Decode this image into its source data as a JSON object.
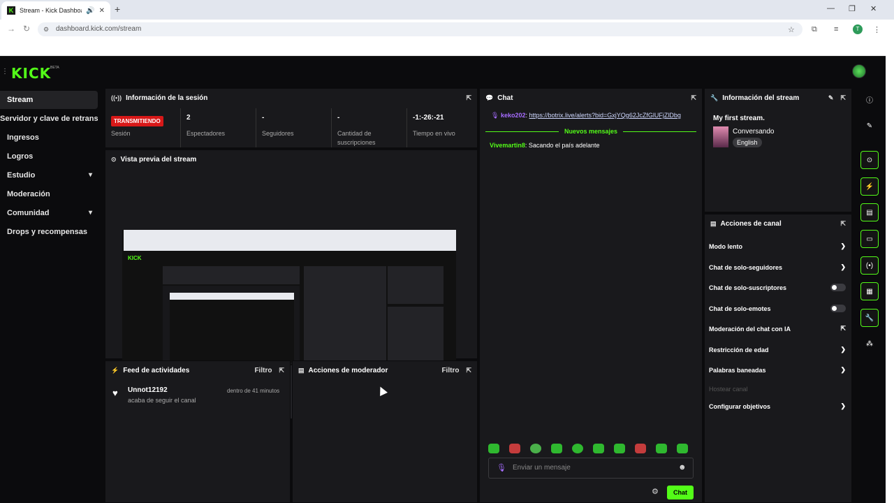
{
  "browser": {
    "tab_title": "Stream - Kick Dashboard",
    "url": "dashboard.kick.com/stream",
    "profile_initial": "T"
  },
  "app": {
    "logo": "KICK",
    "beta": "BETA"
  },
  "sidebar": {
    "items": [
      {
        "label": "Stream"
      },
      {
        "label": "Servidor y clave de retransmisión"
      },
      {
        "label": "Ingresos"
      },
      {
        "label": "Logros"
      },
      {
        "label": "Estudio"
      },
      {
        "label": "Moderación"
      },
      {
        "label": "Comunidad"
      },
      {
        "label": "Drops y recompensas"
      }
    ]
  },
  "session": {
    "title": "Información de la sesión",
    "status_badge": "TRANSMITIENDO",
    "session_label": "Sesión",
    "stats": [
      {
        "value": "2",
        "label": "Espectadores"
      },
      {
        "value": "-",
        "label": "Seguidores"
      },
      {
        "value": "-",
        "label": "Cantidad de suscripciones"
      },
      {
        "value": "-1:-26:-21",
        "label": "Tiempo en vivo"
      }
    ]
  },
  "preview": {
    "title": "Vista previa del stream"
  },
  "feed": {
    "title": "Feed de actividades",
    "filter": "Filtro",
    "items": [
      {
        "user": "Unnot12192",
        "action": "acaba de seguir el canal",
        "time": "dentro de 41 minutos"
      }
    ]
  },
  "mod": {
    "title": "Acciones de moderador",
    "filter": "Filtro"
  },
  "chat": {
    "title": "Chat",
    "pinned_user": "keko202",
    "pinned_link": "https://botrix.live/alerts?bid=GxjYQg62JcZfGlUFjZlDbg",
    "new_messages": "Nuevos mensajes",
    "messages": [
      {
        "user": "Vivemartin8",
        "text": "Sacando el país adelante"
      }
    ],
    "input_placeholder": "Enviar un mensaje",
    "send": "Chat"
  },
  "stream_info": {
    "title": "Información del stream",
    "stream_title": "My first stream.",
    "category": "Conversando",
    "language": "English"
  },
  "channel_actions": {
    "title": "Acciones de canal",
    "items": [
      {
        "label": "Modo lento",
        "control": "chevron"
      },
      {
        "label": "Chat de solo-seguidores",
        "control": "chevron"
      },
      {
        "label": "Chat de solo-suscriptores",
        "control": "toggle"
      },
      {
        "label": "Chat de solo-emotes",
        "control": "toggle"
      },
      {
        "label": "Moderación del chat con IA",
        "control": "external"
      },
      {
        "label": "Restricción de edad",
        "control": "chevron"
      },
      {
        "label": "Palabras baneadas",
        "control": "chevron"
      },
      {
        "label": "Hostear canal",
        "control": "disabled"
      },
      {
        "label": "Configurar objetivos",
        "control": "chevron"
      }
    ]
  },
  "colors": {
    "brand": "#53fc18",
    "live": "#d81818",
    "panel": "#19191c"
  }
}
